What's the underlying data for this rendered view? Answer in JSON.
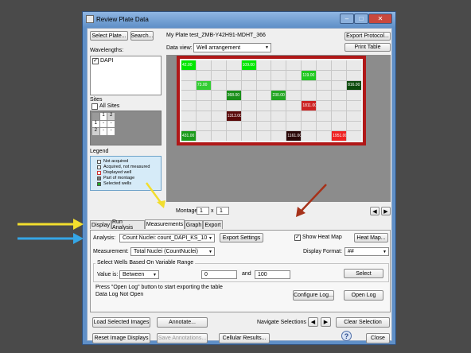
{
  "window": {
    "title": "Review Plate Data",
    "app_icon": "window-app-icon",
    "controls": [
      "minimize",
      "maximize",
      "close"
    ]
  },
  "top": {
    "select_plate": "Select Plate...",
    "search": "Search...",
    "plate_name": "My Plate test_ZMB-Y42H91-MDHT_366",
    "export_protocol": "Export Protocol...",
    "print_table": "Print Table",
    "data_view_label": "Data view:",
    "data_view_value": "Well arrangement"
  },
  "wavelengths": {
    "label": "Wavelengths:",
    "items": [
      {
        "name": "DAPI",
        "checked": true
      }
    ]
  },
  "sites": {
    "label": "Sites",
    "all_sites": "All Sites",
    "grid": [
      [
        "",
        "1",
        "2"
      ],
      [
        "1",
        "-",
        "-"
      ],
      [
        "2",
        "-",
        "-"
      ]
    ]
  },
  "legend": {
    "label": "Legend",
    "items": [
      {
        "text": "Not acquired",
        "color": "#ffffff"
      },
      {
        "text": "Acquired, not measured",
        "color": "#f0f0f0"
      },
      {
        "text": "Displayed well",
        "color": "#ffffff"
      },
      {
        "text": "Part of montage",
        "color": "#777777"
      },
      {
        "text": "Selected wells",
        "color": "#1faa2a"
      }
    ]
  },
  "plate_cells": [
    {
      "row": 0,
      "col": 0,
      "text": "42.00",
      "color": "#00e600"
    },
    {
      "row": 0,
      "col": 4,
      "text": "109.00",
      "color": "#00e600"
    },
    {
      "row": 1,
      "col": 8,
      "text": "119.00",
      "color": "#1fc81f"
    },
    {
      "row": 2,
      "col": 1,
      "text": "73.00",
      "color": "#33cc33"
    },
    {
      "row": 2,
      "col": 11,
      "text": "816.00",
      "color": "#0c4a0c"
    },
    {
      "row": 3,
      "col": 3,
      "text": "368.00",
      "color": "#1a8f1a"
    },
    {
      "row": 3,
      "col": 6,
      "text": "230.00",
      "color": "#22a622"
    },
    {
      "row": 4,
      "col": 8,
      "text": "1811.00",
      "color": "#cc2222"
    },
    {
      "row": 5,
      "col": 3,
      "text": "1313.00",
      "color": "#5a0a0a"
    },
    {
      "row": 7,
      "col": 0,
      "text": "431.00",
      "color": "#1a9a1a"
    },
    {
      "row": 7,
      "col": 7,
      "text": "1161.00",
      "color": "#2a0808"
    },
    {
      "row": 7,
      "col": 10,
      "text": "1951.00",
      "color": "#ee2222"
    }
  ],
  "montage": {
    "label": "Montage:",
    "x_value": "1",
    "y_value": "1",
    "times": "x"
  },
  "tabs": [
    "Display",
    "Run Analysis",
    "Measurements",
    "Graph",
    "Export"
  ],
  "active_tab": "Measurements",
  "analysis": {
    "label": "Analysis:",
    "value": "Count Nuclei: count_DAPI_KS_10",
    "export_settings": "Export Settings",
    "show_heat_map": "Show Heat Map",
    "show_heat_map_checked": true,
    "heat_map_button": "Heat Map..."
  },
  "measurement": {
    "label": "Measurement:",
    "value": "Total Nuclei (CountNuclei)",
    "display_format_label": "Display Format:",
    "display_format_value": "##"
  },
  "select_wells": {
    "group_label": "Select Wells Based On Variable Range",
    "value_is_label": "Value is:",
    "value_is_value": "Between",
    "min": "0",
    "and_label": "and",
    "max": "100",
    "select_button": "Select"
  },
  "log": {
    "hint": "Press \"Open Log\" button to start exporting the table",
    "status": "Data Log Not Open",
    "configure_log": "Configure Log...",
    "open_log": "Open Log"
  },
  "bottom": {
    "load_selected_images": "Load Selected Images",
    "annotate": "Annotate...",
    "navigate_selections": "Navigate Selections",
    "clear_selection": "Clear Selection",
    "reset_image_displays": "Reset Image Displays",
    "save_annotations": "Save Annotations...",
    "cellular_results": "Cellular Results...",
    "close": "Close"
  },
  "colors": {
    "highlight_box": "#b01818",
    "arrow_yellow": "#f2de2e",
    "arrow_blue": "#35a6e6",
    "arrow_red": "#a6321a",
    "window_frame": "#5f8fc7"
  }
}
